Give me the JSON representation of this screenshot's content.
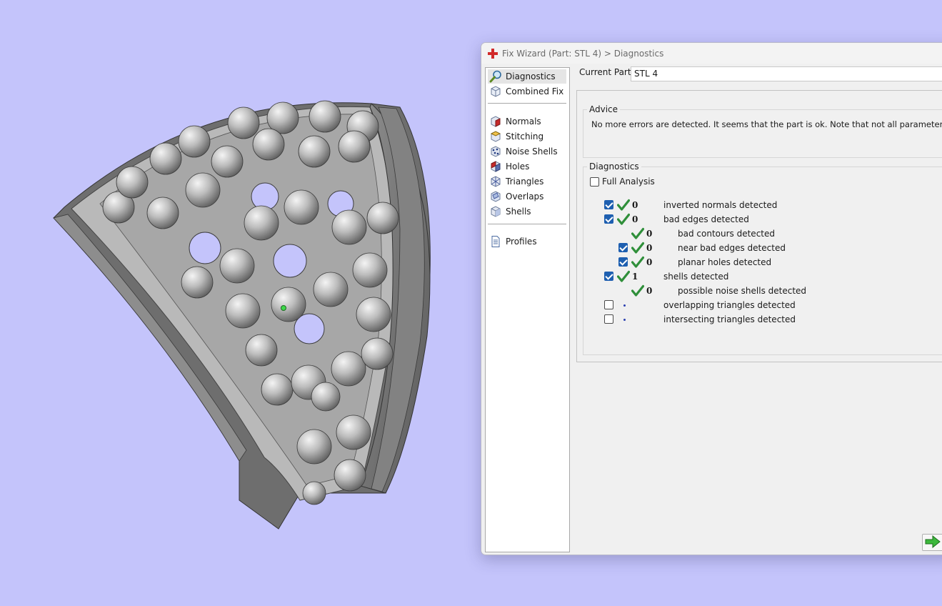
{
  "window": {
    "title": "Fix Wizard (Part: STL 4) > Diagnostics"
  },
  "nav": {
    "items": [
      {
        "label": "Diagnostics",
        "icon": "magnifier-icon",
        "selected": true
      },
      {
        "label": "Combined Fix",
        "icon": "cube-icon"
      },
      {
        "label": "Normals",
        "icon": "normals-cube-icon"
      },
      {
        "label": "Stitching",
        "icon": "stitching-cube-icon"
      },
      {
        "label": "Noise Shells",
        "icon": "noise-shells-icon"
      },
      {
        "label": "Holes",
        "icon": "holes-cube-icon"
      },
      {
        "label": "Triangles",
        "icon": "triangles-cube-icon"
      },
      {
        "label": "Overlaps",
        "icon": "overlaps-cube-icon"
      },
      {
        "label": "Shells",
        "icon": "shells-cube-icon"
      },
      {
        "label": "Profiles",
        "icon": "document-icon"
      }
    ]
  },
  "current_part": {
    "label": "Current Part:",
    "value": "STL 4"
  },
  "advice": {
    "title": "Advice",
    "text": "No more errors are detected. It seems that the part is ok. Note that not all parameters were analysed"
  },
  "diagnostics": {
    "title": "Diagnostics",
    "full_analysis_label": "Full Analysis",
    "full_analysis_checked": false,
    "rows": [
      {
        "checked": true,
        "has_checkbox": true,
        "status": "ok",
        "count": "0",
        "label": "inverted normals detected",
        "indent": 0
      },
      {
        "checked": true,
        "has_checkbox": true,
        "status": "ok",
        "count": "0",
        "label": "bad edges detected",
        "indent": 0
      },
      {
        "checked": false,
        "has_checkbox": false,
        "status": "ok",
        "count": "0",
        "label": "bad contours detected",
        "indent": 1
      },
      {
        "checked": true,
        "has_checkbox": true,
        "status": "ok",
        "count": "0",
        "label": "near bad edges detected",
        "indent": 1
      },
      {
        "checked": true,
        "has_checkbox": true,
        "status": "ok",
        "count": "0",
        "label": "planar holes detected",
        "indent": 1
      },
      {
        "checked": true,
        "has_checkbox": true,
        "status": "ok",
        "count": "1",
        "label": "shells detected",
        "indent": 0
      },
      {
        "checked": false,
        "has_checkbox": false,
        "status": "ok",
        "count": "0",
        "label": "possible noise shells detected",
        "indent": 1
      },
      {
        "checked": false,
        "has_checkbox": true,
        "status": "pending",
        "count": "",
        "label": "overlapping triangles detected",
        "indent": 0
      },
      {
        "checked": false,
        "has_checkbox": true,
        "status": "pending",
        "count": "",
        "label": "intersecting triangles detected",
        "indent": 0
      }
    ]
  },
  "next_button": {
    "icon": "green-arrow-right-icon"
  },
  "colors": {
    "viewport_bg": "#c4c4fb",
    "model": "#9a9a9a",
    "check_green": "#2f8f3a",
    "checkbox_blue": "#1e5fb0"
  }
}
